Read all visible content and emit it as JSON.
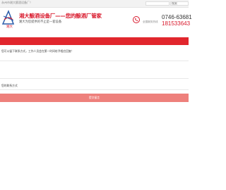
{
  "topbar": {
    "text": "永州市湘大酿酒设备厂！",
    "search_button": "搜索"
  },
  "header": {
    "title": "湘大酿酒设备厂——您的酿酒厂管家",
    "subtitle": "湘大为您提供的不止是一套设备",
    "phone_label": "全国服务热线",
    "phone_1": "0746-63681",
    "phone_2": "181533643",
    "logo_text": "湘大"
  },
  "form": {
    "intro": "您可以留下联系方式，工作人员会在第一时间给予相应回复！",
    "contact_label": "您的联系方式",
    "submit_label": "提交留言"
  },
  "colors": {
    "brand_red": "#e1262d",
    "button_pink": "#ee807c"
  }
}
